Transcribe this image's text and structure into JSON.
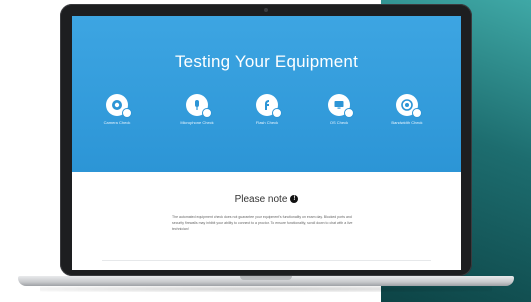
{
  "hero": {
    "title": "Testing Your Equipment"
  },
  "checks": [
    {
      "label": "Camera Check",
      "icon": "camera-icon"
    },
    {
      "label": "Microphone Check",
      "icon": "microphone-icon"
    },
    {
      "label": "Flash Check",
      "icon": "flash-icon"
    },
    {
      "label": "OS Check",
      "icon": "monitor-icon"
    },
    {
      "label": "Bandwidth Check",
      "icon": "bandwidth-icon"
    }
  ],
  "note": {
    "title": "Please note",
    "icon": "info-icon",
    "body": "The automated equipment check does not guarantee your equipment's functionality on exam day. Blocked ports and security firewalls may inhibit your ability to connect to a proctor. To ensure functionality, scroll down to chat with a live technician!"
  },
  "colors": {
    "hero_blue": "#2c95d6",
    "teal": "#1d6d6f",
    "bezel": "#1d1e20"
  }
}
